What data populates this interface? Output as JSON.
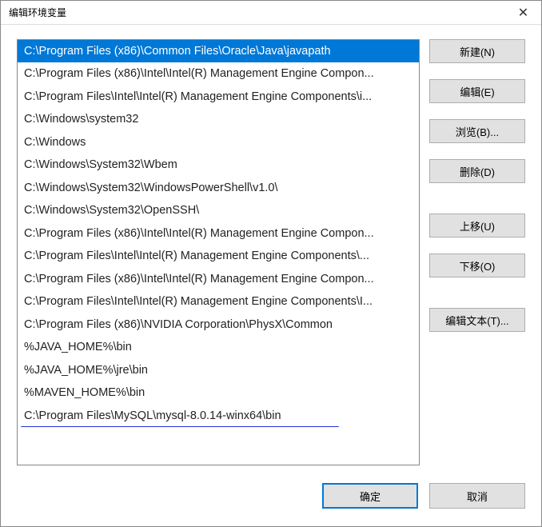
{
  "window": {
    "title": "编辑环境变量"
  },
  "list": {
    "items": [
      {
        "text": "C:\\Program Files (x86)\\Common Files\\Oracle\\Java\\javapath",
        "selected": true
      },
      {
        "text": "C:\\Program Files (x86)\\Intel\\Intel(R) Management Engine Compon..."
      },
      {
        "text": "C:\\Program Files\\Intel\\Intel(R) Management Engine Components\\i..."
      },
      {
        "text": "C:\\Windows\\system32"
      },
      {
        "text": "C:\\Windows"
      },
      {
        "text": "C:\\Windows\\System32\\Wbem"
      },
      {
        "text": "C:\\Windows\\System32\\WindowsPowerShell\\v1.0\\"
      },
      {
        "text": "C:\\Windows\\System32\\OpenSSH\\"
      },
      {
        "text": "C:\\Program Files (x86)\\Intel\\Intel(R) Management Engine Compon..."
      },
      {
        "text": "C:\\Program Files\\Intel\\Intel(R) Management Engine Components\\..."
      },
      {
        "text": "C:\\Program Files (x86)\\Intel\\Intel(R) Management Engine Compon..."
      },
      {
        "text": "C:\\Program Files\\Intel\\Intel(R) Management Engine Components\\I..."
      },
      {
        "text": "C:\\Program Files (x86)\\NVIDIA Corporation\\PhysX\\Common"
      },
      {
        "text": "%JAVA_HOME%\\bin"
      },
      {
        "text": "%JAVA_HOME%\\jre\\bin"
      },
      {
        "text": "%MAVEN_HOME%\\bin"
      },
      {
        "text": "C:\\Program Files\\MySQL\\mysql-8.0.14-winx64\\bin",
        "underlined": true
      }
    ]
  },
  "buttons": {
    "new": "新建(N)",
    "edit": "编辑(E)",
    "browse": "浏览(B)...",
    "delete": "删除(D)",
    "move_up": "上移(U)",
    "move_down": "下移(O)",
    "edit_text": "编辑文本(T)...",
    "ok": "确定",
    "cancel": "取消"
  }
}
